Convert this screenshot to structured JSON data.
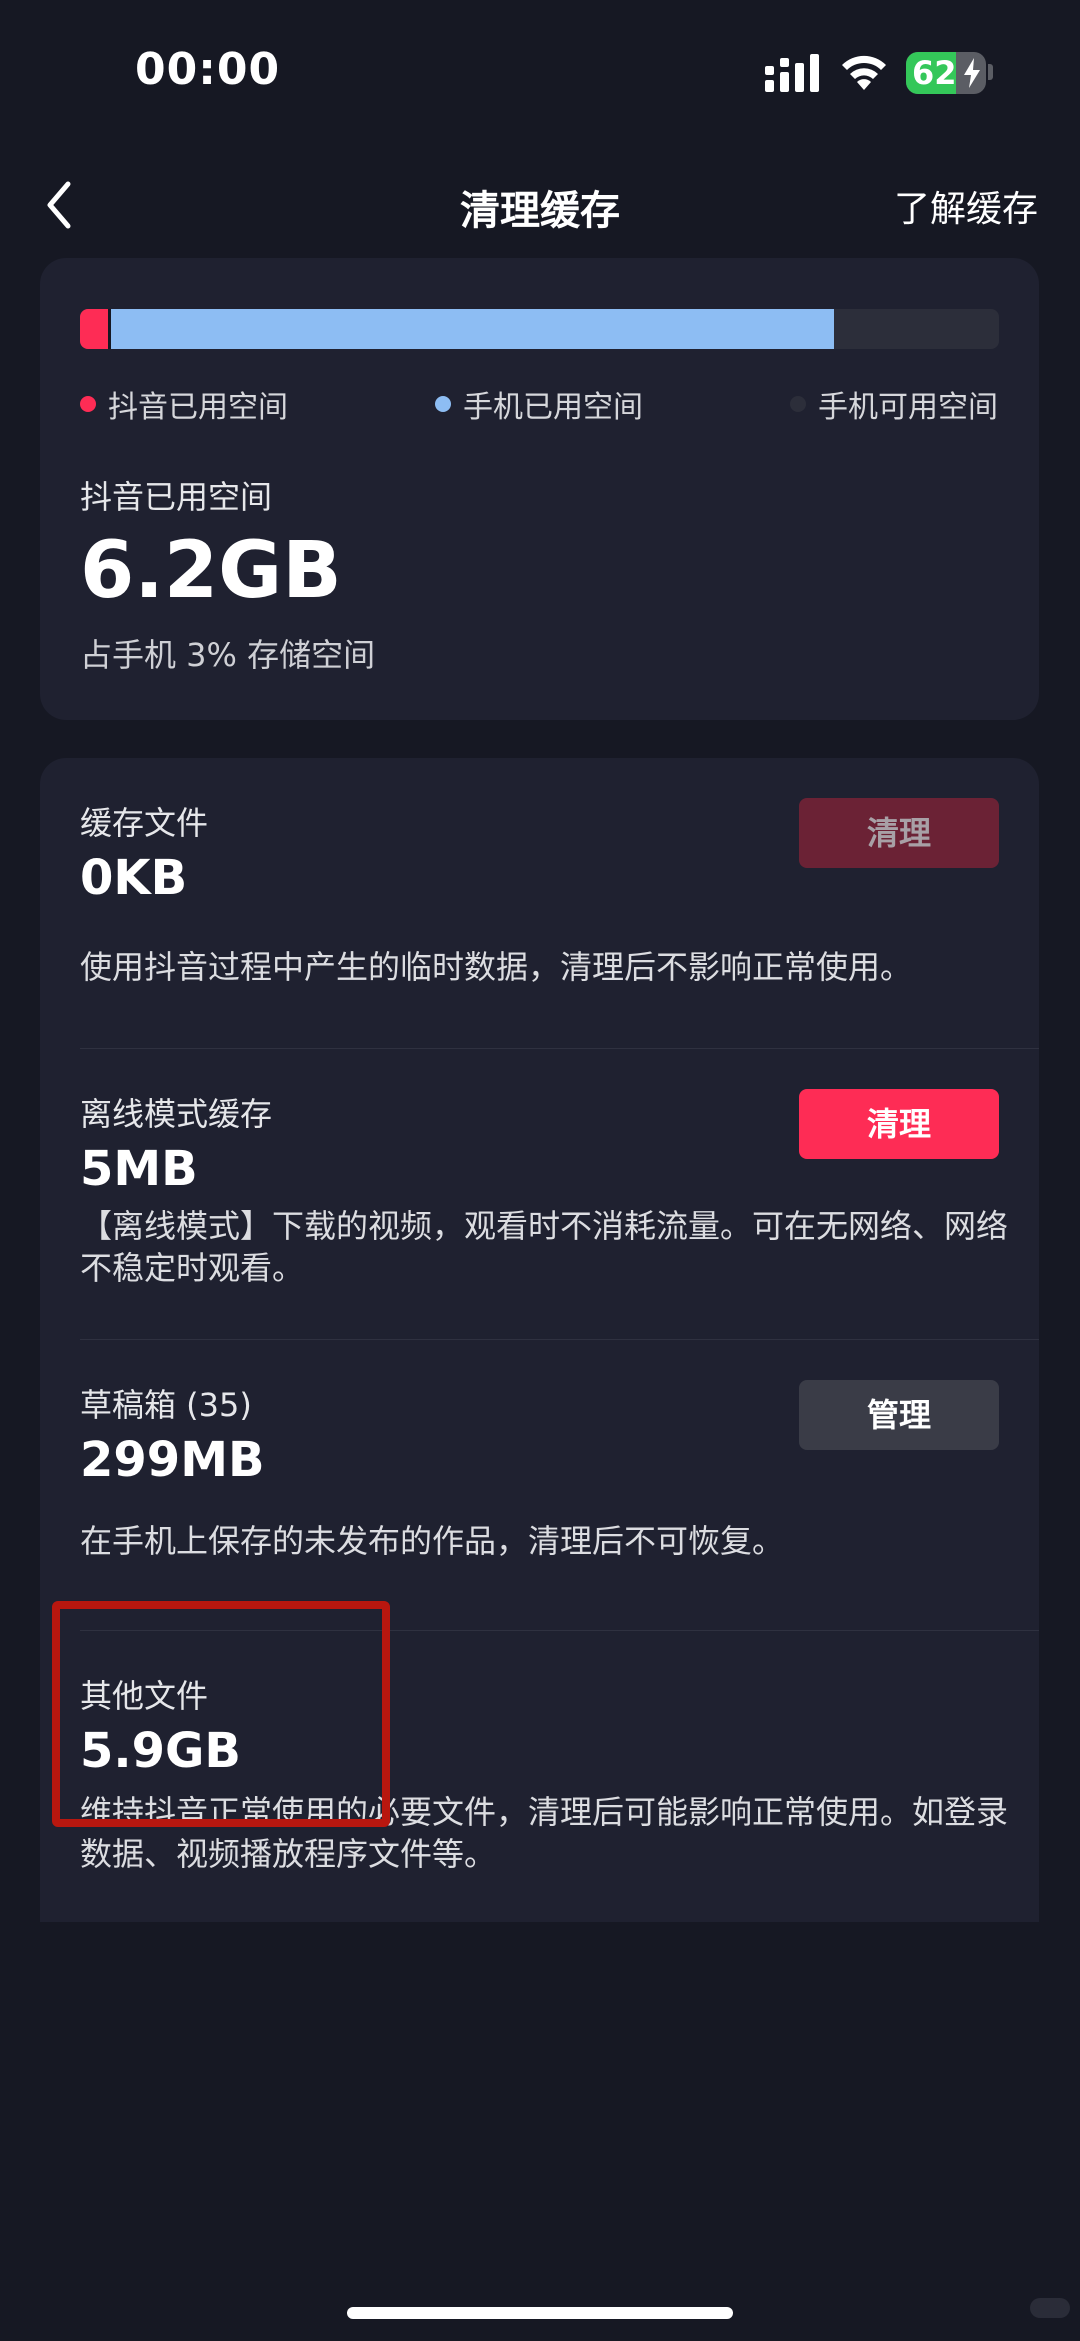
{
  "status_bar": {
    "time": "00:00",
    "battery_level": "62",
    "battery_fraction": 0.62,
    "icons": [
      "signal-icon",
      "wifi-icon",
      "battery-icon",
      "charging-bolt-icon"
    ]
  },
  "nav": {
    "back_icon": "chevron-left-icon",
    "title": "清理缓存",
    "action_label": "了解缓存"
  },
  "storage": {
    "bar": {
      "app_used_fraction": 0.03,
      "phone_used_fraction": 0.79,
      "colors": {
        "app_used": "#fe2c55",
        "phone_used": "#8dbdf3",
        "phone_free": "#2c2e3a"
      }
    },
    "legend": {
      "app_used": "抖音已用空间",
      "phone_used": "手机已用空间",
      "phone_free": "手机可用空间"
    },
    "label": "抖音已用空间",
    "value": "6.2GB",
    "caption": "占手机 3% 存储空间"
  },
  "items": [
    {
      "title": "缓存文件",
      "size": "0KB",
      "button": "清理",
      "description": "使用抖音过程中产生的临时数据，清理后不影响正常使用。"
    },
    {
      "title": "离线模式缓存",
      "size": "5MB",
      "button": "清理",
      "description": "【离线模式】下载的视频，观看时不消耗流量。可在无网络、网络不稳定时观看。"
    },
    {
      "title": "草稿箱 (35)",
      "size": "299MB",
      "button": "管理",
      "description": "在手机上保存的未发布的作品，清理后不可恢复。"
    },
    {
      "title": "其他文件",
      "size": "5.9GB",
      "description": "维持抖音正常使用的必要文件，清理后可能影响正常使用。如登录数据、视频播放程序文件等。"
    }
  ],
  "colors": {
    "background": "#161823",
    "card": "#1f2130",
    "accent": "#fe2c55",
    "highlight_annotation": "#b8170f"
  }
}
